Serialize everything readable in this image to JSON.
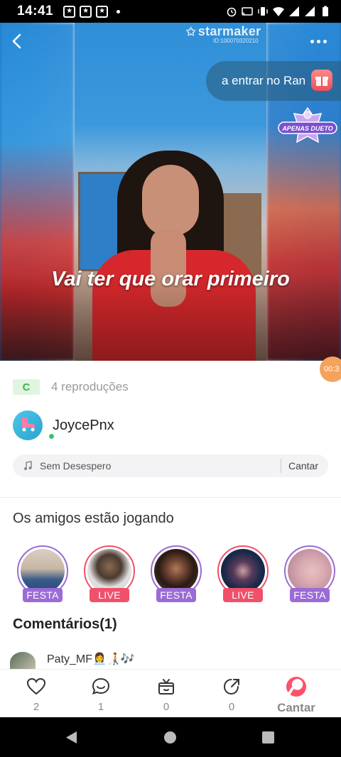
{
  "status_bar": {
    "time": "14:41",
    "notification_icons": [
      "star-app-icon",
      "star-app-icon",
      "star-app-icon"
    ]
  },
  "video": {
    "watermark": "starmaker",
    "watermark_id": "ID:100070320210",
    "banner_text": "a entrar no Ran",
    "badge": "APENAS DUETO",
    "lyric": "Vai ter que orar primeiro",
    "timer": "00:3"
  },
  "meta": {
    "grade": "C",
    "plays": "4 reproduções"
  },
  "author": {
    "name": "JoycePnx"
  },
  "song": {
    "title": "Sem Desespero",
    "action": "Cantar"
  },
  "friends": {
    "title": "Os amigos estão jogando",
    "items": [
      {
        "tag": "FESTA",
        "type": "festa"
      },
      {
        "tag": "LIVE",
        "type": "live"
      },
      {
        "tag": "FESTA",
        "type": "festa"
      },
      {
        "tag": "LIVE",
        "type": "live"
      },
      {
        "tag": "FESTA",
        "type": "festa"
      }
    ]
  },
  "comments": {
    "title": "Comentários(1)",
    "first_user": "Paty_MF👩‍💼🧑‍🦯🎶"
  },
  "actions": {
    "likes": "2",
    "comments": "1",
    "gifts": "0",
    "shares": "0",
    "sing_label": "Cantar"
  },
  "colors": {
    "accent": "#ff4f6a",
    "festa": "#9b6bd6",
    "live": "#f0506a",
    "grade_green": "#3cb44b"
  }
}
